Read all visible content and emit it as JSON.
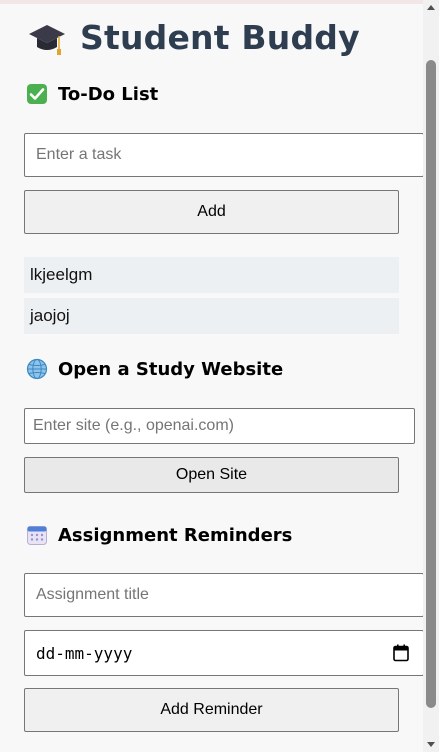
{
  "app": {
    "title": "Student Buddy",
    "icon": "graduation-cap-icon"
  },
  "todo": {
    "heading": "To-Do List",
    "icon": "check-mark-button-icon",
    "input_placeholder": "Enter a task",
    "add_label": "Add",
    "items": [
      "lkjeelgm",
      "jaojoj"
    ]
  },
  "website": {
    "heading": "Open a Study Website",
    "icon": "globe-icon",
    "input_placeholder": "Enter site (e.g., openai.com)",
    "open_label": "Open Site"
  },
  "reminders": {
    "heading": "Assignment Reminders",
    "icon": "calendar-icon",
    "title_placeholder": "Assignment title",
    "date_placeholder": "dd-mm-yyyy",
    "add_label": "Add Reminder"
  },
  "colors": {
    "title": "#2e3e50",
    "item_bg": "#edf0f2",
    "check_green": "#4cb050",
    "globe_blue": "#3b88c3"
  }
}
